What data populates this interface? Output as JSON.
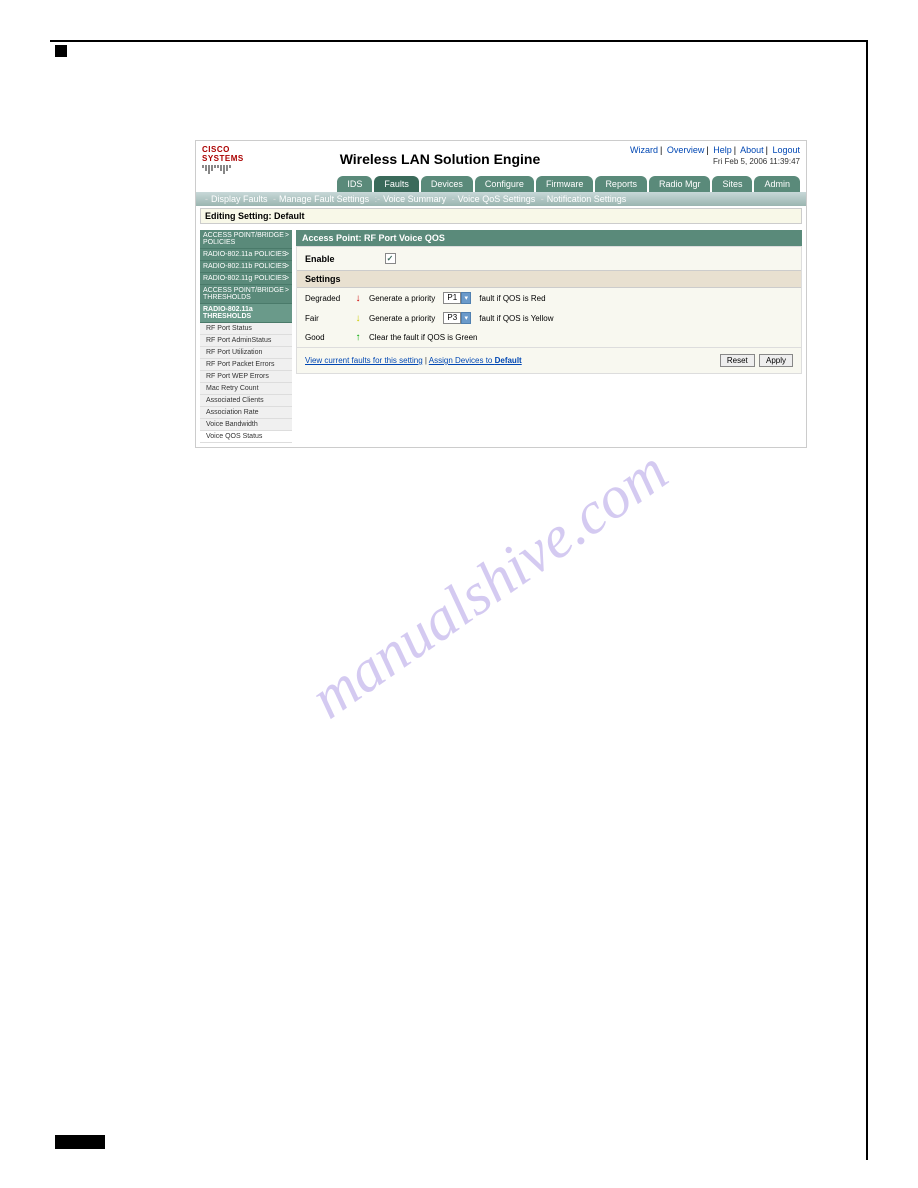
{
  "watermark": "manualshive.com",
  "header": {
    "logo": "CISCO SYSTEMS",
    "title": "Wireless LAN Solution Engine",
    "links": [
      "Wizard",
      "Overview",
      "Help",
      "About",
      "Logout"
    ],
    "timestamp": "Fri Feb 5, 2006 11:39:47"
  },
  "tabs": [
    "IDS",
    "Faults",
    "Devices",
    "Configure",
    "Firmware",
    "Reports",
    "Radio Mgr",
    "Sites",
    "Admin"
  ],
  "active_tab": "Faults",
  "subnav": [
    "Display Faults",
    "Manage Fault Settings",
    "Voice Summary",
    "Voice QoS Settings",
    "Notification Settings"
  ],
  "editing_bar": "Editing Setting: Default",
  "sidebar": {
    "groups": [
      {
        "label": "ACCESS POINT/BRIDGE POLICIES"
      },
      {
        "label": "RADIO-802.11a POLICIES"
      },
      {
        "label": "RADIO-802.11b POLICIES"
      },
      {
        "label": "RADIO-802.11g POLICIES"
      },
      {
        "label": "ACCESS POINT/BRIDGE THRESHOLDS"
      },
      {
        "label": "RADIO-802.11a THRESHOLDS",
        "expanded": true
      }
    ],
    "items": [
      "RF Port Status",
      "RF Port AdminStatus",
      "RF Port Utilization",
      "RF Port Packet Errors",
      "RF Port WEP Errors",
      "Mac Retry Count",
      "Associated Clients",
      "Association Rate",
      "Voice Bandwidth",
      "Voice QOS Status"
    ],
    "active_item": "Voice QOS Status"
  },
  "panel": {
    "title": "Access Point: RF Port Voice QOS",
    "enable_label": "Enable",
    "enable_checked": true,
    "settings_label": "Settings",
    "rows": [
      {
        "label": "Degraded",
        "icon": "↓",
        "icon_class": "arrow-red",
        "text_before": "Generate a priority",
        "priority": "P1",
        "text_after": "fault if QOS is Red"
      },
      {
        "label": "Fair",
        "icon": "↓",
        "icon_class": "arrow-yellow",
        "text_before": "Generate a priority",
        "priority": "P3",
        "text_after": "fault if QOS is Yellow"
      },
      {
        "label": "Good",
        "icon": "↑",
        "icon_class": "arrow-green",
        "text_full": "Clear the fault if QOS is Green"
      }
    ],
    "footer": {
      "link1": "View current faults for this setting",
      "sep": " | ",
      "link2_prefix": "Assign Devices to ",
      "link2_bold": "Default",
      "reset": "Reset",
      "apply": "Apply"
    }
  }
}
